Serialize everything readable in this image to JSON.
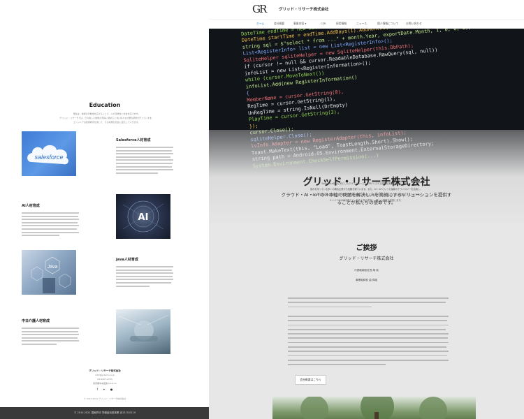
{
  "left_page": {
    "section_title": "Education",
    "intro_lines": [
      "現在は、技術の可能性を広げることで、人の可能性と社会を広げます。",
      "グリッド・リサーチでは、日々新しい技術の習得に努めると共に様々な分野の研修を行っています。",
      "エンジニアの技術教育を通じて、その成果を社会に還元していきます。"
    ],
    "items": [
      {
        "heading": "Salesforce人材育成",
        "logo_text": "salesforce"
      },
      {
        "heading": "AI人材育成",
        "logo_text": "AI"
      },
      {
        "heading": "Java人材育成",
        "logo_text": "Java"
      },
      {
        "heading": "中日介護人材育成"
      }
    ],
    "footer": {
      "company": "グリッド・リサーチ株式会社",
      "line1": "info@gr-tech.co.jp",
      "line2": "03-6457-4703",
      "line3": "東京都中央区新川2-9-11"
    },
    "social_icons": [
      "facebook-icon",
      "twitter-icon",
      "line-icon"
    ],
    "copyright_small": "© 2015-2021 グリッド・リサーチ株式会社",
    "copyright_bar": "© 2015-2021 国家許可 労働者派遣事業 派13-310119"
  },
  "right_page": {
    "logo": {
      "letters": "GR"
    },
    "site_title": "グリッド・リサーチ株式会社",
    "nav": [
      {
        "label": "ホーム",
        "active": true
      },
      {
        "label": "会社概要"
      },
      {
        "label": "事業内容 ▾"
      },
      {
        "label": "CSR"
      },
      {
        "label": "採用情報"
      },
      {
        "label": "ニュース"
      },
      {
        "label": "個人情報について"
      },
      {
        "label": "お問い合わせ"
      }
    ],
    "hero": {
      "code_lines": [
        "DateTime startTime = sDatePicker.DateTime;",
        "DateTime endTime = new DateTime(startDate.Year, endDate.Month, 1, 0, 0, 0);",
        "DateTime startTime = endTime.AddDays(1).AddMonths(-1).AddDays(-1);",
        "string sql = $\"select * from ...\" + month.Year, exportDate.Month, 1, 0, 0, 0);",
        "List<RegisterInfo> list = new List<RegisterInfo>();",
        "SqliteHelper sqliteHelper = new SqliteHelper(this.DbPath);",
        "if (cursor != null && cursor.ReadableDatabase.RawQuery(sql, null))",
        "  infoList = new List<RegisterInformation>();",
        "  while (cursor.MoveToNext())",
        "",
        "  infoList.Add(new RegisterInformation()",
        "  {",
        "    MemberName = cursor.GetString(0),",
        "    RegTime = cursor.GetString(1),",
        "    UnRegTime = string.IsNull(DrEmpty)",
        "    PlayTime = cursor.GetString(3),",
        "  });",
        "cursor.Close();",
        "sqliteHelper.Close();",
        "lvInfo.Adapter = new RegisterAdapter(this, infoList);",
        "Toast.MakeText(this, \"Load\", ToastLength.Short).Show();",
        "string path = Android.OS.Environment.ExternalStorageDirectory;",
        "System.Environment.CheckSelfPermission(...)"
      ],
      "title": "グリッド・リサーチ株式会社",
      "tagline_1": "クラウド・AI・IoTの３本柱で問題を解決し人を笑顔にするソリューションを提供す",
      "tagline_2": "ることが私たちの使命です。",
      "desc_lines": [
        "Salesforceをはじめとしたクラウドベースの CRM システム開発を実施することに加え、",
        "強みを持っている多くの著名企業から信頼を得ています。また、AI・IoTといった最新のテクノロジーを活用し、",
        "ヘルスケア領域での新規製品・新サービスを創出しています。私たちのビジョンは、人を笑顔にすることです。",
        "エンジニアの力を通じて、社会と共に成長し、新しい価値を創造します。"
      ]
    },
    "greeting": {
      "title": "ご挨拶",
      "company": "グリッド・リサーチ株式会社",
      "signature_1": "代表取締役社長 胡 琰",
      "signature_2": "事業取締役 曲 偉強",
      "button_label": "会社概要はこちら"
    }
  }
}
